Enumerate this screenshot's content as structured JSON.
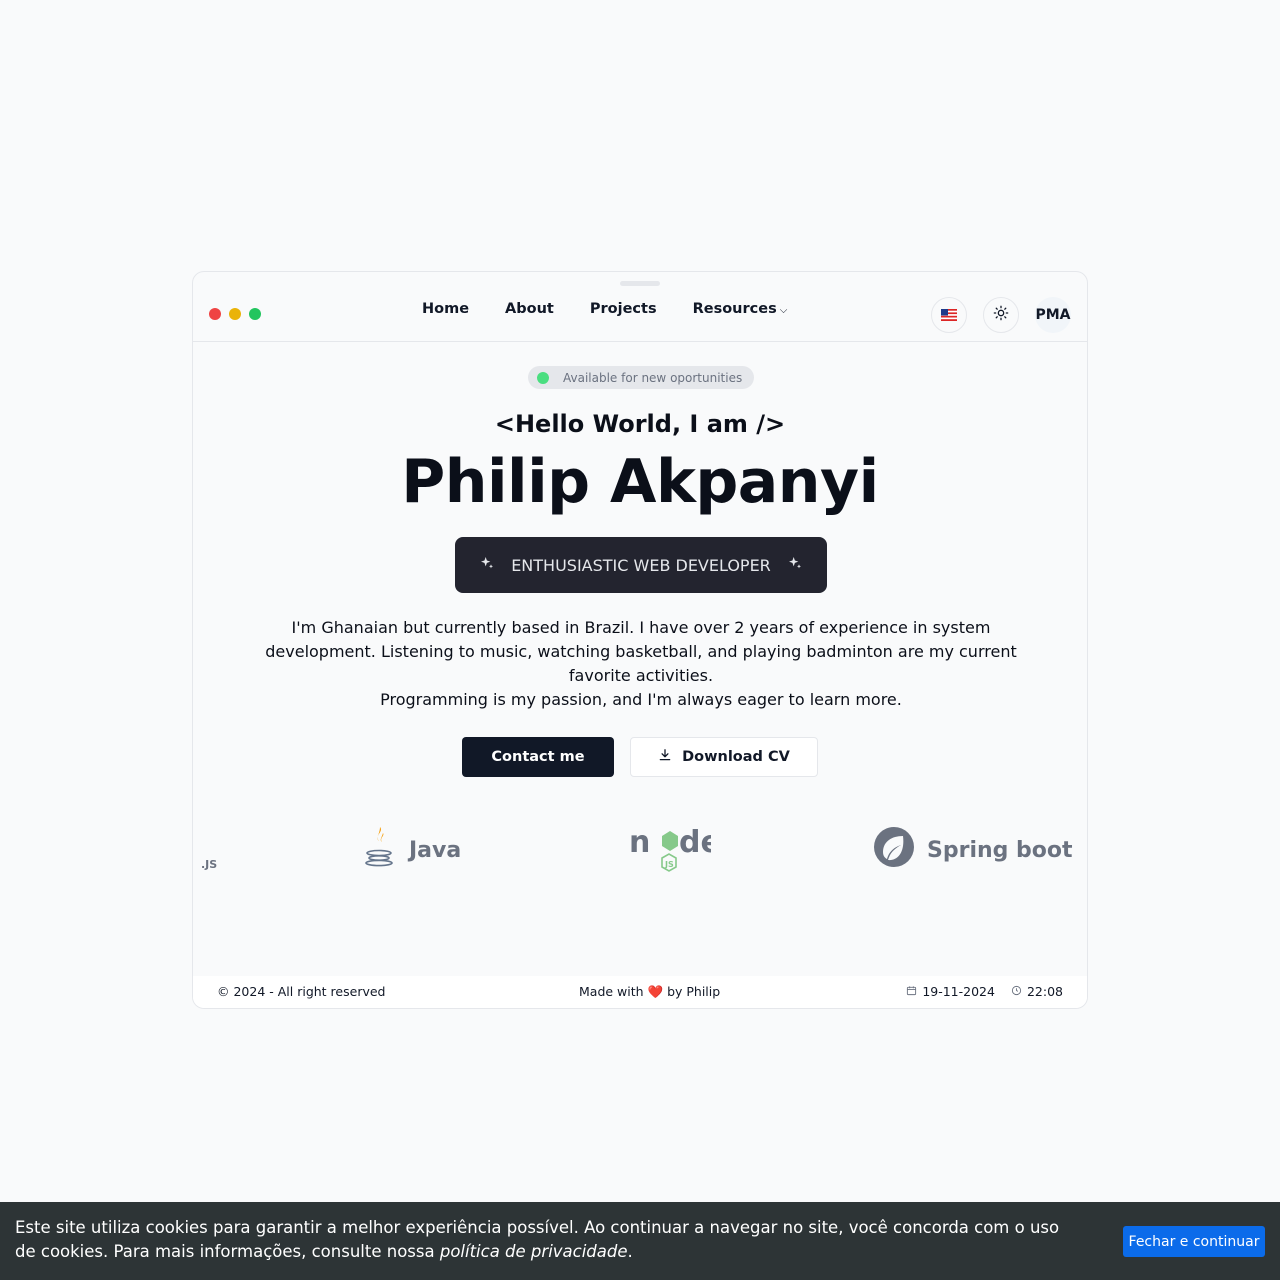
{
  "window": {
    "traffic_lights": [
      "#ef4444",
      "#eab308",
      "#22c55e"
    ]
  },
  "nav": {
    "items": [
      "Home",
      "About",
      "Projects",
      "Resources"
    ],
    "resources_chevron": "⌵"
  },
  "tools": {
    "language_icon": "us-flag-icon",
    "theme_icon": "sun-icon",
    "initials": "PMA"
  },
  "hero": {
    "availability": "Available for new oportunities",
    "greeting": "<Hello World, I am />",
    "name": "Philip Akpanyi",
    "role": "ENTHUSIASTIC WEB DEVELOPER",
    "bio_line1": "I'm Ghanaian but currently based in Brazil. I have over 2 years of experience in system development. Listening to music, watching basketball, and playing badminton are my current favorite activities.",
    "bio_line2": "Programming is my passion, and I'm always eager to learn more.",
    "contact_label": "Contact me",
    "cv_label": "Download CV"
  },
  "tech": {
    "js_label": ".JS",
    "java_label": "Java",
    "spring_label": "Spring boot"
  },
  "footer": {
    "copyright": "© 2024 - All right reserved",
    "made_with": "Made with ❤️ by Philip",
    "date": "19-11-2024",
    "time": "22:08"
  },
  "cookie": {
    "text": "Este site utiliza cookies para garantir a melhor experiência possível. Ao continuar a navegar no site, você concorda com o uso de cookies. Para mais informações, consulte nossa ",
    "policy_link": "política de privacidade",
    "period": ".",
    "button": "Fechar e continuar"
  },
  "colors": {
    "accent": "#0b6bea",
    "dark": "#111827",
    "available_dot": "#4ade80"
  }
}
